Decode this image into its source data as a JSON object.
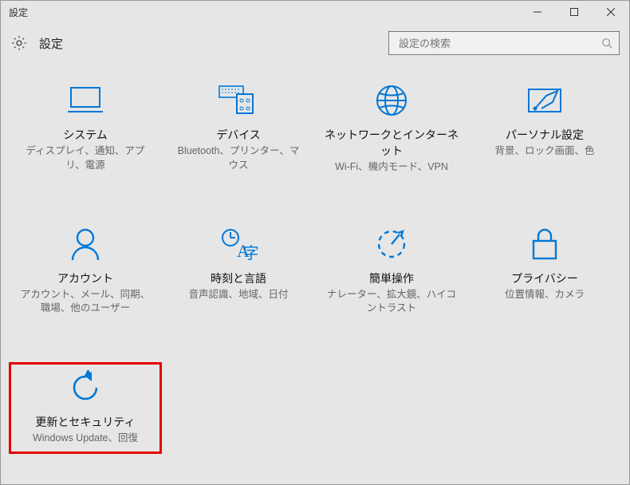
{
  "window": {
    "title": "設定"
  },
  "header": {
    "label": "設定"
  },
  "search": {
    "placeholder": "設定の検索"
  },
  "tiles": [
    {
      "icon": "system",
      "title": "システム",
      "desc": "ディスプレイ、通知、アプリ、電源"
    },
    {
      "icon": "devices",
      "title": "デバイス",
      "desc": "Bluetooth、プリンター、マウス"
    },
    {
      "icon": "network",
      "title": "ネットワークとインターネット",
      "desc": "Wi-Fi、機内モード、VPN"
    },
    {
      "icon": "personal",
      "title": "パーソナル設定",
      "desc": "背景、ロック画面、色"
    },
    {
      "icon": "account",
      "title": "アカウント",
      "desc": "アカウント、メール、同期、職場、他のユーザー"
    },
    {
      "icon": "time",
      "title": "時刻と言語",
      "desc": "音声認識、地域、日付"
    },
    {
      "icon": "ease",
      "title": "簡単操作",
      "desc": "ナレーター、拡大鏡、ハイコントラスト"
    },
    {
      "icon": "privacy",
      "title": "プライバシー",
      "desc": "位置情報、カメラ"
    },
    {
      "icon": "update",
      "title": "更新とセキュリティ",
      "desc": "Windows Update、回復",
      "highlight": true
    }
  ]
}
